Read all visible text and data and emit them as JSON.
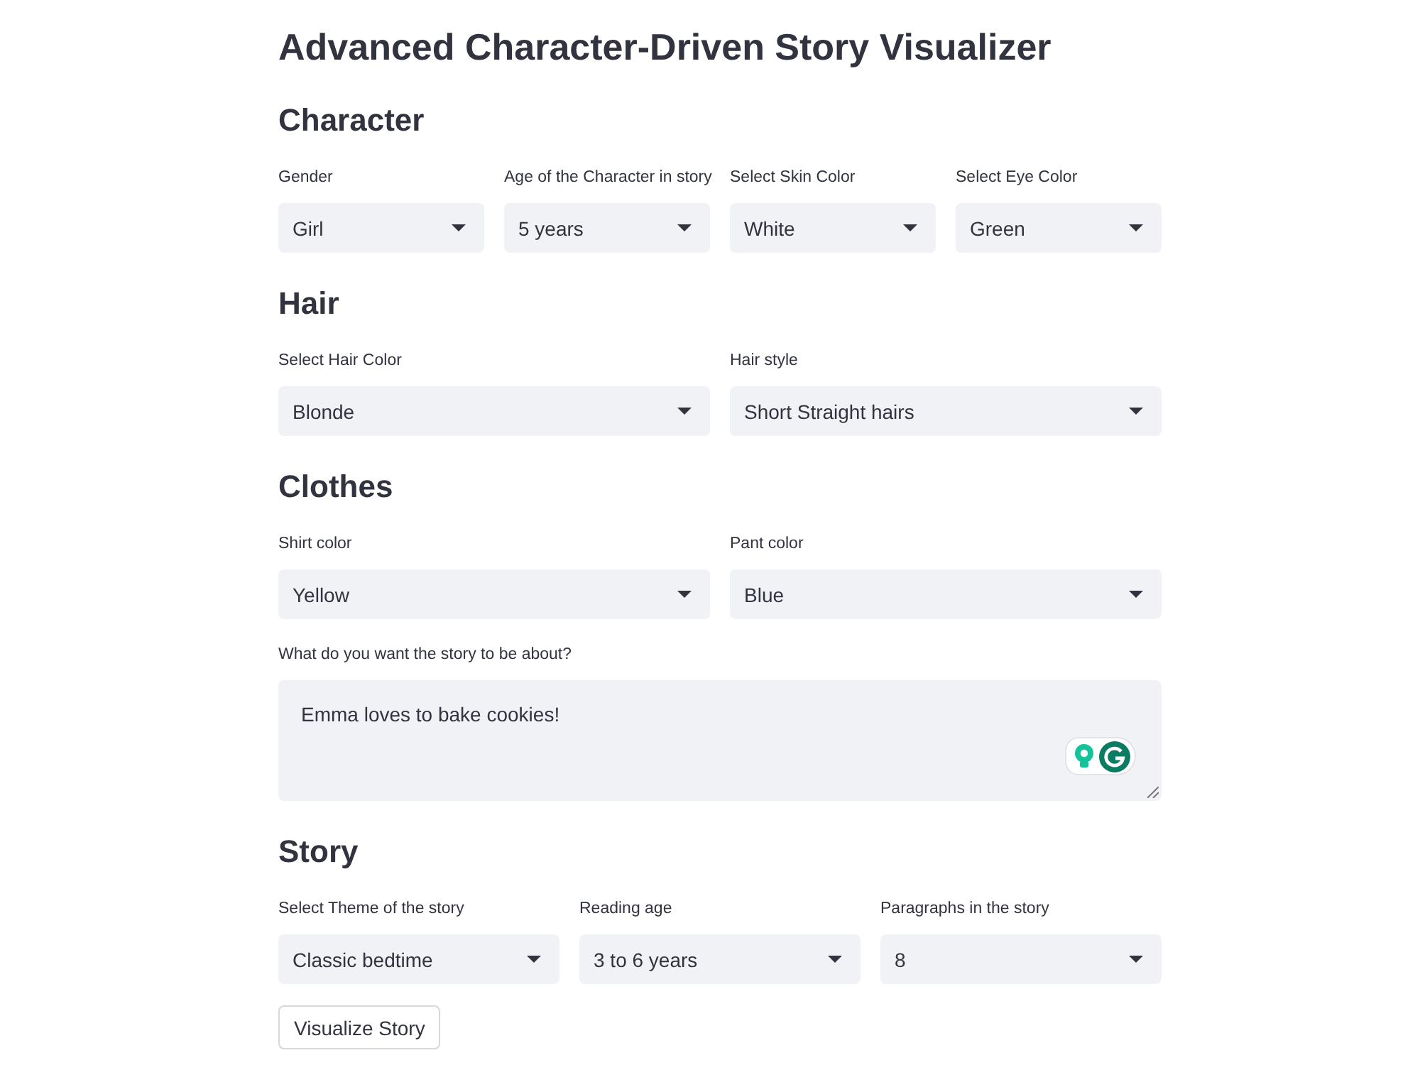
{
  "title": "Advanced Character-Driven Story Visualizer",
  "sections": [
    {
      "heading": "Character",
      "rows": [
        [
          {
            "kind": "select",
            "label": "Gender",
            "value": "Girl"
          },
          {
            "kind": "select",
            "label": "Age of the Character in story",
            "value": "5 years"
          },
          {
            "kind": "select",
            "label": "Select Skin Color",
            "value": "White"
          },
          {
            "kind": "select",
            "label": "Select Eye Color",
            "value": "Green"
          }
        ]
      ]
    },
    {
      "heading": "Hair",
      "rows": [
        [
          {
            "kind": "select",
            "label": "Select Hair Color",
            "value": "Blonde"
          },
          {
            "kind": "select",
            "label": "Hair style",
            "value": "Short Straight hairs"
          }
        ]
      ]
    },
    {
      "heading": "Clothes",
      "rows": [
        [
          {
            "kind": "select",
            "label": "Shirt color",
            "value": "Yellow"
          },
          {
            "kind": "select",
            "label": "Pant color",
            "value": "Blue"
          }
        ],
        [
          {
            "kind": "textarea",
            "label": "What do you want the story to be about?",
            "value": "Emma loves to bake cookies!"
          }
        ]
      ]
    },
    {
      "heading": "Story",
      "rows": [
        [
          {
            "kind": "select",
            "label": "Select Theme of the story",
            "value": "Classic bedtime"
          },
          {
            "kind": "select",
            "label": "Reading age",
            "value": "3 to 6 years"
          },
          {
            "kind": "select",
            "label": "Paragraphs in the story",
            "value": "8"
          }
        ]
      ]
    }
  ],
  "button": {
    "label": "Visualize Story"
  }
}
